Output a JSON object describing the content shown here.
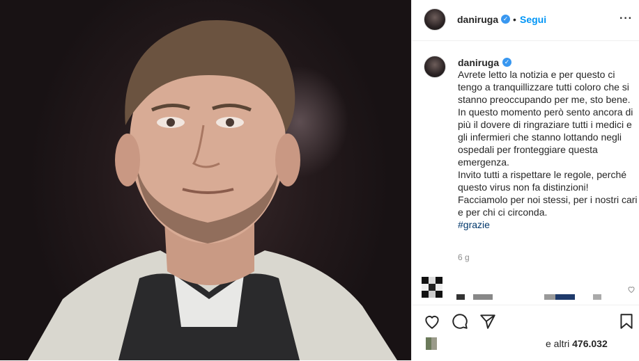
{
  "post": {
    "username": "daniruga",
    "verified_icon": "verified-badge-icon",
    "separator": "•",
    "follow_label": "Segui",
    "more_label": "···",
    "caption_lines": [
      "Avrete letto la notizia e per questo ci tengo a tranquillizzare tutti coloro che si stanno preoccupando per me, sto bene.",
      "In questo momento però sento ancora di più il dovere di ringraziare tutti i medici e gli infermieri che stanno lottando negli ospedali per fronteggiare questa emergenza.",
      "Invito tutti a rispettare le regole, perché questo virus non fa distinzioni!",
      "Facciamolo per noi stessi, per i nostri cari e per chi ci circonda."
    ],
    "hashtag": "#grazie",
    "time_ago": "6 g",
    "likes_prefix": "e altri ",
    "likes_count": "476.032",
    "accent_color": "#0095f6"
  }
}
